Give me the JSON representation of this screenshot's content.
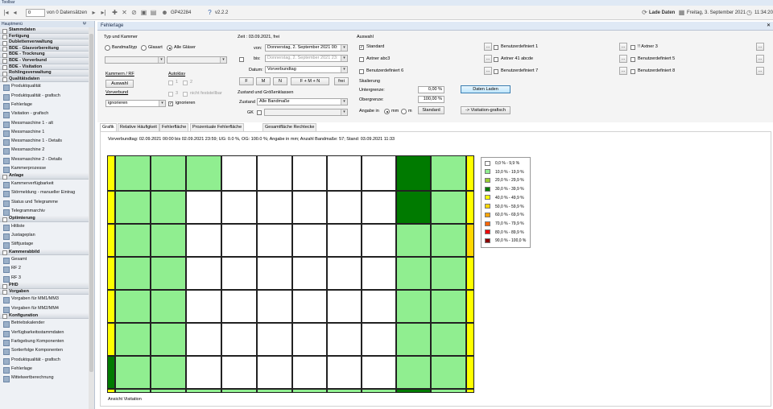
{
  "window": {
    "title": "Toolbar"
  },
  "toolbar": {
    "record_input": "0",
    "record_of": "von 0 Datensätzen",
    "user_id": "GP42284",
    "version": "v2.2.2",
    "lade_daten": "Lade Daten",
    "date": "Freitag, 3. September 2021",
    "time": "11:34:20"
  },
  "sidebar": {
    "title": "Hauptmenü",
    "pin": "Ψ",
    "entries": [
      {
        "type": "section",
        "label": "Stammdaten"
      },
      {
        "type": "section",
        "label": "Fertigung"
      },
      {
        "type": "section",
        "label": "Dublettenverwaltung"
      },
      {
        "type": "section",
        "label": "BDE - Glasvorbereitung"
      },
      {
        "type": "section",
        "label": "BDE - Trocknung"
      },
      {
        "type": "section",
        "label": "BDE - Vorverbund"
      },
      {
        "type": "section",
        "label": "BDE - Visitation"
      },
      {
        "type": "section",
        "label": "Rohlingsverwaltung"
      },
      {
        "type": "section",
        "label": "Qualitätsdaten"
      },
      {
        "type": "item",
        "label": "Produktqualität"
      },
      {
        "type": "item",
        "label": "Produktqualität - grafisch"
      },
      {
        "type": "item",
        "label": "Fehlerlage"
      },
      {
        "type": "item",
        "label": "Visitation - grafisch"
      },
      {
        "type": "item",
        "label": "Messmaschine 1 - alt"
      },
      {
        "type": "item",
        "label": "Messmaschine 1"
      },
      {
        "type": "item",
        "label": "Messmaschine 1 - Details"
      },
      {
        "type": "item",
        "label": "Messmaschine 2"
      },
      {
        "type": "item",
        "label": "Messmaschine 2 - Details"
      },
      {
        "type": "item",
        "label": "Kammerprozesse"
      },
      {
        "type": "section",
        "label": "Anlage"
      },
      {
        "type": "item",
        "label": "Kammerverfügbarkeit"
      },
      {
        "type": "item",
        "label": "Störmeldung - manueller Eintrag"
      },
      {
        "type": "item",
        "label": "Status und Telegramme"
      },
      {
        "type": "item",
        "label": "Telegrammarchiv"
      },
      {
        "type": "section",
        "label": "Optimierung"
      },
      {
        "type": "item",
        "label": "Hitliste"
      },
      {
        "type": "item",
        "label": "Justageplan"
      },
      {
        "type": "item",
        "label": "Stiftjustage"
      },
      {
        "type": "section",
        "label": "Kammerabbild"
      },
      {
        "type": "item",
        "label": "Gesamt"
      },
      {
        "type": "item",
        "label": "RF 2"
      },
      {
        "type": "item",
        "label": "RF 3"
      },
      {
        "type": "section",
        "label": "PHD"
      },
      {
        "type": "section",
        "label": "Vorgaben"
      },
      {
        "type": "item",
        "label": "Vorgaben für MM1/MM3"
      },
      {
        "type": "item",
        "label": "Vorgaben für MM2/MM4"
      },
      {
        "type": "section",
        "label": "Konfiguration"
      },
      {
        "type": "item",
        "label": "Betriebskalender"
      },
      {
        "type": "item",
        "label": "Verfügbarkeitsstammdaten"
      },
      {
        "type": "item",
        "label": "Farbgebung Komponenten"
      },
      {
        "type": "item",
        "label": "Sortierfolge Komponenten"
      },
      {
        "type": "item",
        "label": "Produktqualität - grafisch"
      },
      {
        "type": "item",
        "label": "Fehlerlage"
      },
      {
        "type": "item",
        "label": "Mittelwertberechnung"
      }
    ]
  },
  "doc_tab": {
    "title": "Fehlerlage",
    "close": "✕"
  },
  "filter": {
    "typ_kammer": {
      "title": "Typ und Kammer",
      "options": [
        "Bandmaßtyp",
        "Glasart",
        "Alle Gläser"
      ],
      "selected": "Alle Gläser"
    },
    "kammern_title": "Kammern / RF",
    "auswahl_btn": "Auswahl",
    "autoklav_title": "Autoklav",
    "autoklav_options": [
      "1",
      "2",
      "3",
      "nicht feststellbar"
    ],
    "vorverbund_title": "Vorverbund",
    "vorverbund_value": "ignorieren",
    "ignorieren_label": "ignorieren",
    "zeit": {
      "title": "Zeit : 03.09.2021, frei",
      "von_label": "von:",
      "von_value": "Donnerstag, 2. September 2021 00:",
      "bis_label": "bis:",
      "bis_value": "Donnerstag, 2. September 2021 23:",
      "datum_label": "Datum:",
      "datum_value": "Vorverbundtag",
      "buttons": [
        "F",
        "M",
        "N",
        "F + M + N",
        "frei"
      ]
    },
    "zustand": {
      "title": "Zustand und Größenklassen",
      "label": "Zustand",
      "value": "Alle Bandmaße",
      "gk_label": "GK"
    }
  },
  "auswahl": {
    "title": "Auswahl",
    "checkboxes": [
      {
        "label": "Standard",
        "checked": true
      },
      {
        "label": "Benutzerdefiniert 1",
        "checked": false
      },
      {
        "label": "!! Axtner 3",
        "checked": false
      },
      {
        "label": "Axtner abc3",
        "checked": false
      },
      {
        "label": "Axtner 41 abcde",
        "checked": false
      },
      {
        "label": "Benutzerdefiniert 5",
        "checked": false
      },
      {
        "label": "Benutzerdefiniert 6",
        "checked": false
      },
      {
        "label": "Benutzerdefiniert 7",
        "checked": false
      },
      {
        "label": "Benutzerdefiniert 8",
        "checked": false
      }
    ],
    "dots": "..."
  },
  "skalierung": {
    "title": "Skalierung",
    "untergrenze_label": "Untergrenze:",
    "untergrenze_value": "0,00 %",
    "obergrenze_label": "Obergrenze:",
    "obergrenze_value": "100,00 %",
    "angabe_label": "Angabe in",
    "angabe_options": [
      "mm",
      "m"
    ],
    "angabe_selected": "mm",
    "standard_btn": "Standard",
    "daten_laden_btn": "Daten Laden",
    "visitation_btn": "-> Visitation-grafisch"
  },
  "result_tabs": [
    "Grafik",
    "Relative Häufigkeit",
    "Fehlerfläche",
    "Prozentuale Fehlerfläche",
    "Gesamtfläche Rechtecke"
  ],
  "active_result_tab": "Grafik",
  "info_line": "Vorverbundtag: 02.09.2021 00:00 bis 02.09.2021 23:59; UG: 0.0 %, OG: 100.0 %; Angabe in mm; Anzahl Bandmaße: 57; Stand: 03.09.2021 11:33",
  "footer_label": "Ansicht Visitation",
  "chart_data": {
    "type": "heatmap",
    "legend": [
      {
        "label": "0,0 % - 9,9 %",
        "color": "#ffffff"
      },
      {
        "label": "10,0 % - 19,9 %",
        "color": "#90ee90"
      },
      {
        "label": "20,0 % - 29,9 %",
        "color": "#9acd32"
      },
      {
        "label": "30,0 % - 39,9 %",
        "color": "#007a00"
      },
      {
        "label": "40,0 % - 49,9 %",
        "color": "#ffff00"
      },
      {
        "label": "50,0 % - 59,9 %",
        "color": "#ffd700"
      },
      {
        "label": "60,0 % - 69,9 %",
        "color": "#ffa500"
      },
      {
        "label": "70,0 % - 79,9 %",
        "color": "#ff6600"
      },
      {
        "label": "80,0 % - 89,9 %",
        "color": "#ee0000"
      },
      {
        "label": "90,0 % - 100,0 %",
        "color": "#8b0000"
      }
    ],
    "rows": [
      [
        "Y",
        "LG",
        "LG",
        "LG",
        "W",
        "W",
        "W",
        "W",
        "W",
        "DG",
        "LG",
        "Y"
      ],
      [
        "Y",
        "LG",
        "LG",
        "W",
        "W",
        "W",
        "W",
        "W",
        "W",
        "DG",
        "LG",
        "Y"
      ],
      [
        "Y",
        "LG",
        "LG",
        "W",
        "W",
        "W",
        "W",
        "W",
        "W",
        "LG",
        "LG",
        "G"
      ],
      [
        "Y",
        "LG",
        "LG",
        "W",
        "W",
        "W",
        "W",
        "W",
        "W",
        "LG",
        "LG",
        "Y"
      ],
      [
        "Y",
        "LG",
        "LG",
        "W",
        "W",
        "W",
        "W",
        "W",
        "W",
        "LG",
        "LG",
        "Y"
      ],
      [
        "Y",
        "LG",
        "LG",
        "W",
        "W",
        "W",
        "W",
        "W",
        "W",
        "LG",
        "LG",
        "Y"
      ],
      [
        "DG",
        "LG",
        "LG",
        "W",
        "W",
        "W",
        "W",
        "W",
        "W",
        "LG",
        "LG",
        "Y"
      ],
      [
        "Y",
        "LG",
        "LG",
        "LG",
        "LG",
        "LG",
        "LG",
        "LG",
        "LG",
        "DG",
        "LG",
        "Y"
      ]
    ],
    "color_key": {
      "W": "#ffffff",
      "LG": "#90ee90",
      "YG": "#9acd32",
      "DG": "#007a00",
      "Y": "#ffff00",
      "G": "#ffd700"
    }
  }
}
